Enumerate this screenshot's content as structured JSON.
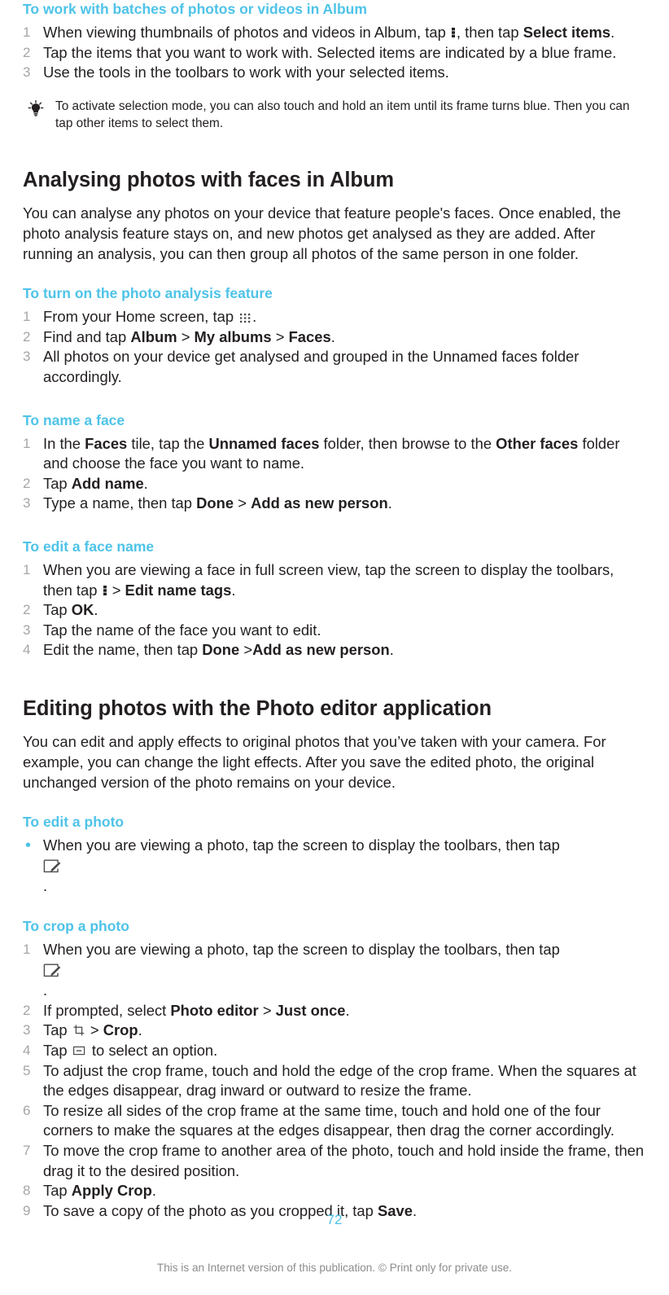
{
  "document": {
    "page_number": "72",
    "footer_note": "This is an Internet version of this publication. © Print only for private use.",
    "accent_color": "#4ec3e8",
    "text_color": "#231f20",
    "step_number_color": "#a6a6a6"
  },
  "section_batches": {
    "heading": "To work with batches of photos or videos in Album",
    "steps": [
      {
        "number": "1",
        "parts": [
          {
            "text": "When viewing thumbnails of photos and videos in Album, tap "
          },
          {
            "icon": "overflow-menu-icon"
          },
          {
            "text": ", then tap "
          },
          {
            "bold": "Select items"
          },
          {
            "text": "."
          }
        ]
      },
      {
        "number": "2",
        "parts": [
          {
            "text": "Tap the items that you want to work with. Selected items are indicated by a blue frame."
          }
        ]
      },
      {
        "number": "3",
        "parts": [
          {
            "text": "Use the tools in the toolbars to work with your selected items."
          }
        ]
      }
    ],
    "tip": {
      "icon": "lightbulb-tip-icon",
      "text": "To activate selection mode, you can also touch and hold an item until its frame turns blue. Then you can tap other items to select them."
    }
  },
  "section_analysing": {
    "heading": "Analysing photos with faces in Album",
    "body": "You can analyse any photos on your device that feature people's faces. Once enabled, the photo analysis feature stays on, and new photos get analysed as they are added. After running an analysis, you can then group all photos of the same person in one folder.",
    "sub_turn_on": {
      "heading": "To turn on the photo analysis feature",
      "steps": [
        {
          "number": "1",
          "parts": [
            {
              "text": "From your Home screen, tap "
            },
            {
              "icon": "app-grid-icon"
            },
            {
              "text": "."
            }
          ]
        },
        {
          "number": "2",
          "parts": [
            {
              "text": "Find and tap "
            },
            {
              "bold": "Album"
            },
            {
              "text": " > "
            },
            {
              "bold": "My albums"
            },
            {
              "text": " > "
            },
            {
              "bold": "Faces"
            },
            {
              "text": "."
            }
          ]
        },
        {
          "number": "3",
          "parts": [
            {
              "text": "All photos on your device get analysed and grouped in the Unnamed faces folder accordingly."
            }
          ]
        }
      ]
    },
    "sub_name_face": {
      "heading": "To name a face",
      "steps": [
        {
          "number": "1",
          "parts": [
            {
              "text": "In the "
            },
            {
              "bold": "Faces"
            },
            {
              "text": " tile, tap the "
            },
            {
              "bold": "Unnamed faces"
            },
            {
              "text": " folder, then browse to the "
            },
            {
              "bold": "Other faces"
            },
            {
              "text": " folder and choose the face you want to name."
            }
          ]
        },
        {
          "number": "2",
          "parts": [
            {
              "text": "Tap "
            },
            {
              "bold": "Add name"
            },
            {
              "text": "."
            }
          ]
        },
        {
          "number": "3",
          "parts": [
            {
              "text": "Type a name, then tap "
            },
            {
              "bold": "Done"
            },
            {
              "text": " > "
            },
            {
              "bold": "Add as new person"
            },
            {
              "text": "."
            }
          ]
        }
      ]
    },
    "sub_edit_face": {
      "heading": "To edit a face name",
      "steps": [
        {
          "number": "1",
          "parts": [
            {
              "text": "When you are viewing a face in full screen view, tap the screen to display the toolbars, then tap "
            },
            {
              "icon": "overflow-menu-icon"
            },
            {
              "text": " > "
            },
            {
              "bold": "Edit name tags"
            },
            {
              "text": "."
            }
          ]
        },
        {
          "number": "2",
          "parts": [
            {
              "text": "Tap "
            },
            {
              "bold": "OK"
            },
            {
              "text": "."
            }
          ]
        },
        {
          "number": "3",
          "parts": [
            {
              "text": "Tap the name of the face you want to edit."
            }
          ]
        },
        {
          "number": "4",
          "parts": [
            {
              "text": "Edit the name, then tap "
            },
            {
              "bold": "Done"
            },
            {
              "text": " >"
            },
            {
              "bold": "Add as new person"
            },
            {
              "text": "."
            }
          ]
        }
      ]
    }
  },
  "section_editing": {
    "heading": "Editing photos with the Photo editor application",
    "body": "You can edit and apply effects to original photos that you’ve taken with your camera. For example, you can change the light effects. After you save the edited photo, the original unchanged version of the photo remains on your device.",
    "sub_edit_photo": {
      "heading": "To edit a photo",
      "bullets": [
        {
          "bullet": "•",
          "parts": [
            {
              "text": "When you are viewing a photo, tap the screen to display the toolbars, then tap "
            },
            {
              "icon_block": "photo-editor-icon"
            },
            {
              "text": "."
            }
          ]
        }
      ]
    },
    "sub_crop_photo": {
      "heading": "To crop a photo",
      "steps": [
        {
          "number": "1",
          "parts": [
            {
              "text": "When you are viewing a photo, tap the screen to display the toolbars, then tap "
            },
            {
              "icon_block": "photo-editor-icon"
            },
            {
              "text": "."
            }
          ]
        },
        {
          "number": "2",
          "parts": [
            {
              "text": "If prompted, select "
            },
            {
              "bold": "Photo editor"
            },
            {
              "text": " > "
            },
            {
              "bold": "Just once"
            },
            {
              "text": "."
            }
          ]
        },
        {
          "number": "3",
          "parts": [
            {
              "text": "Tap "
            },
            {
              "icon": "crop-icon"
            },
            {
              "text": " > "
            },
            {
              "bold": "Crop"
            },
            {
              "text": "."
            }
          ]
        },
        {
          "number": "4",
          "parts": [
            {
              "text": "Tap "
            },
            {
              "icon": "aspect-ratio-icon"
            },
            {
              "text": " to select an option."
            }
          ]
        },
        {
          "number": "5",
          "parts": [
            {
              "text": "To adjust the crop frame, touch and hold the edge of the crop frame. When the squares at the edges disappear, drag inward or outward to resize the frame."
            }
          ]
        },
        {
          "number": "6",
          "parts": [
            {
              "text": "To resize all sides of the crop frame at the same time, touch and hold one of the four corners to make the squares at the edges disappear, then drag the corner accordingly."
            }
          ]
        },
        {
          "number": "7",
          "parts": [
            {
              "text": "To move the crop frame to another area of the photo, touch and hold inside the frame, then drag it to the desired position."
            }
          ]
        },
        {
          "number": "8",
          "parts": [
            {
              "text": "Tap "
            },
            {
              "bold": "Apply Crop"
            },
            {
              "text": "."
            }
          ]
        },
        {
          "number": "9",
          "parts": [
            {
              "text": "To save a copy of the photo as you cropped it, tap "
            },
            {
              "bold": "Save"
            },
            {
              "text": "."
            }
          ]
        }
      ]
    }
  }
}
